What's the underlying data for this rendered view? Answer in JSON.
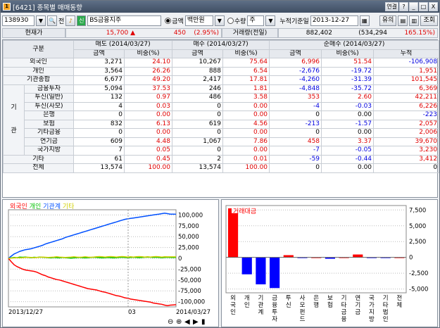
{
  "window": {
    "number": "1",
    "title": "[6421] 종목별 매매동향",
    "buttons": [
      "연결",
      "?",
      "_",
      "□",
      "X"
    ]
  },
  "toolbar": {
    "code": "138930",
    "jeon": "전",
    "sin": "신",
    "stock_name": "BS금융지주",
    "radio_amount": "금액",
    "unit": "백만원",
    "radio_qty": "수량",
    "period": "주",
    "ref_date_label": "누적기준일",
    "ref_date": "2013-12-27",
    "btn_yuui": "유의",
    "btn_query": "조회"
  },
  "quote": {
    "price_label": "현재가",
    "price": "15,700",
    "change_arrow": "▲",
    "change": "450",
    "change_pct": "(2.95%)",
    "volume_label": "거래량(전일)",
    "volume": "882,402",
    "prev_volume": "(534,294",
    "volume_pct": "165.15%)"
  },
  "table": {
    "header_group": [
      "구분",
      "매도 (2014/03/27)",
      "매수 (2014/03/27)",
      "순매수 (2014/03/27)"
    ],
    "header_sub": [
      "금액",
      "비중(%)",
      "금액",
      "비중(%)",
      "금액",
      "비중(%)",
      "누적"
    ],
    "gi_label": "기",
    "gwan_label": "관",
    "rows": [
      {
        "label": "외국인",
        "indent": false,
        "cells": [
          "3,271",
          "24.10",
          "10,267",
          "75.64",
          "6,996",
          "51.54",
          "-106,908"
        ],
        "cls": [
          "",
          "red",
          "",
          "red",
          "red",
          "red",
          "blue"
        ]
      },
      {
        "label": "개인",
        "indent": false,
        "cells": [
          "3,564",
          "26.26",
          "888",
          "6.54",
          "-2,676",
          "-19.72",
          "1,951"
        ],
        "cls": [
          "",
          "red",
          "",
          "red",
          "blue",
          "blue",
          "red"
        ]
      },
      {
        "label": "기관종합",
        "indent": false,
        "cells": [
          "6,677",
          "49.20",
          "2,417",
          "17.81",
          "-4,260",
          "-31.39",
          "101,545"
        ],
        "cls": [
          "",
          "red",
          "",
          "red",
          "blue",
          "blue",
          "red"
        ]
      },
      {
        "label": "금융투자",
        "indent": true,
        "cells": [
          "5,094",
          "37.53",
          "246",
          "1.81",
          "-4,848",
          "-35.72",
          "6,369"
        ],
        "cls": [
          "",
          "red",
          "",
          "red",
          "blue",
          "blue",
          "red"
        ]
      },
      {
        "label": "투신(일반)",
        "indent": true,
        "cells": [
          "132",
          "0.97",
          "486",
          "3.58",
          "353",
          "2.60",
          "42,211"
        ],
        "cls": [
          "",
          "red",
          "",
          "red",
          "red",
          "red",
          "red"
        ]
      },
      {
        "label": "투신(사모)",
        "indent": true,
        "cells": [
          "4",
          "0.03",
          "0",
          "0.00",
          "-4",
          "-0.03",
          "6,226"
        ],
        "cls": [
          "",
          "red",
          "",
          "red",
          "blue",
          "blue",
          "red"
        ]
      },
      {
        "label": "은행",
        "indent": true,
        "cells": [
          "0",
          "0.00",
          "0",
          "0.00",
          "0",
          "0.00",
          "-223"
        ],
        "cls": [
          "",
          "red",
          "",
          "red",
          "",
          "",
          "blue"
        ]
      },
      {
        "label": "보험",
        "indent": true,
        "cells": [
          "832",
          "6.13",
          "619",
          "4.56",
          "-213",
          "-1.57",
          "2,057"
        ],
        "cls": [
          "",
          "red",
          "",
          "red",
          "blue",
          "blue",
          "red"
        ]
      },
      {
        "label": "기타금융",
        "indent": true,
        "cells": [
          "0",
          "0.00",
          "0",
          "0.00",
          "0",
          "0.00",
          "2,006"
        ],
        "cls": [
          "",
          "red",
          "",
          "red",
          "",
          "",
          "red"
        ]
      },
      {
        "label": "연기금",
        "indent": true,
        "cells": [
          "609",
          "4.48",
          "1,067",
          "7.86",
          "458",
          "3.37",
          "39,670"
        ],
        "cls": [
          "",
          "red",
          "",
          "red",
          "red",
          "red",
          "red"
        ]
      },
      {
        "label": "국가지방",
        "indent": true,
        "cells": [
          "7",
          "0.05",
          "0",
          "0.00",
          "-7",
          "-0.05",
          "3,230"
        ],
        "cls": [
          "",
          "red",
          "",
          "red",
          "blue",
          "blue",
          "red"
        ]
      },
      {
        "label": "기타",
        "indent": false,
        "cells": [
          "61",
          "0.45",
          "2",
          "0.01",
          "-59",
          "-0.44",
          "3,412"
        ],
        "cls": [
          "",
          "red",
          "",
          "red",
          "blue",
          "blue",
          "red"
        ]
      },
      {
        "label": "전체",
        "indent": false,
        "cells": [
          "13,574",
          "100.00",
          "13,574",
          "100.00",
          "0",
          "0.00",
          "0"
        ],
        "cls": [
          "",
          "red",
          "",
          "red",
          "",
          "",
          ""
        ]
      }
    ]
  },
  "chart_data": [
    {
      "type": "line",
      "legend": [
        "외국인",
        "개인",
        "기관계",
        "기타"
      ],
      "colors": [
        "#ff0000",
        "#00c000",
        "#0050ff",
        "#d0d000"
      ],
      "yticks": [
        100000,
        75000,
        50000,
        25000,
        0,
        -25000,
        -50000,
        -75000,
        -100000
      ],
      "ytick_labels": [
        "100,000",
        "75,000",
        "50,000",
        "25,000",
        "0",
        "-25,000",
        "-50,000",
        "-75,000",
        "-100,000"
      ],
      "ylim": [
        -112000,
        112000
      ],
      "xlabels": [
        "2013/12/27",
        "03",
        "2014/03/27"
      ],
      "n_points": 60,
      "series": [
        {
          "name": "외국인",
          "values": [
            0,
            -8000,
            -15000,
            -19000,
            -22000,
            -25000,
            -27000,
            -28000,
            -29000,
            -30000,
            -32000,
            -35000,
            -38000,
            -40000,
            -43000,
            -45000,
            -47000,
            -49000,
            -50000,
            -52000,
            -54000,
            -56000,
            -58000,
            -60000,
            -62000,
            -64000,
            -66000,
            -68000,
            -70000,
            -71000,
            -72000,
            -73000,
            -75000,
            -77000,
            -78000,
            -80000,
            -82000,
            -84000,
            -86000,
            -87000,
            -89000,
            -91000,
            -92000,
            -94000,
            -95000,
            -96000,
            -97000,
            -98000,
            -99000,
            -100000,
            -101000,
            -103000,
            -104000,
            -105000,
            -106000,
            -108000,
            -109000,
            -108000,
            -107500,
            -106908
          ]
        },
        {
          "name": "개인",
          "values": [
            0,
            1000,
            2000,
            1500,
            3000,
            2500,
            3000,
            2000,
            1500,
            2500,
            2000,
            3000,
            2500,
            2000,
            1500,
            1000,
            2000,
            1500,
            1000,
            2000,
            1500,
            1000,
            500,
            1000,
            1500,
            2000,
            1500,
            1000,
            1500,
            2000,
            2500,
            2000,
            1500,
            1000,
            1500,
            2000,
            1500,
            1000,
            1500,
            2000,
            2500,
            2000,
            1500,
            2000,
            2500,
            2000,
            1500,
            2000,
            2500,
            3000,
            2500,
            2000,
            2500,
            2000,
            1500,
            2000,
            2500,
            2000,
            1800,
            1951
          ]
        },
        {
          "name": "기관계",
          "values": [
            0,
            5000,
            10000,
            13000,
            16000,
            18000,
            20000,
            21000,
            22000,
            24000,
            26000,
            28000,
            30000,
            33000,
            35000,
            37000,
            39000,
            41000,
            43000,
            45000,
            48000,
            50000,
            52000,
            54000,
            56000,
            58000,
            60000,
            62000,
            64000,
            66000,
            68000,
            70000,
            72000,
            74000,
            76000,
            78000,
            80000,
            82000,
            84000,
            86000,
            88000,
            90000,
            91000,
            92000,
            93000,
            94000,
            95000,
            96000,
            97000,
            98000,
            99000,
            100000,
            101000,
            102000,
            103000,
            104000,
            103000,
            102000,
            101800,
            101545
          ]
        },
        {
          "name": "기타",
          "values": [
            0,
            500,
            1000,
            1500,
            1000,
            1500,
            2000,
            2500,
            2000,
            1500,
            2000,
            2500,
            3000,
            2500,
            2000,
            2500,
            3000,
            3500,
            3000,
            2500,
            2000,
            2500,
            3000,
            3500,
            3000,
            2500,
            3000,
            3500,
            3000,
            2500,
            3000,
            3500,
            4000,
            3500,
            3000,
            3500,
            4000,
            3500,
            3000,
            3500,
            4000,
            3500,
            3000,
            3500,
            3000,
            3500,
            4000,
            3500,
            3000,
            3500,
            3000,
            3500,
            4000,
            3500,
            3000,
            3500,
            3400,
            3450,
            3420,
            3412
          ]
        }
      ]
    },
    {
      "type": "bar",
      "legend": [
        "거래대금"
      ],
      "categories": [
        "외국인",
        "개인",
        "기관계",
        "금융투자",
        "투신",
        "사모펀드",
        "은행",
        "보험",
        "기타금융",
        "연기금",
        "국가지방",
        "기타법인",
        "전체"
      ],
      "values": [
        6996,
        -2676,
        -4260,
        -4848,
        353,
        -4,
        0,
        -213,
        0,
        458,
        -7,
        -59,
        0
      ],
      "yticks": [
        7500,
        5000,
        2500,
        0,
        -2500,
        -5000
      ],
      "ytick_labels": [
        "7,500",
        "5,000",
        "2,500",
        "0",
        "-2,500",
        "-5,000"
      ],
      "ylim": [
        -5600,
        8200
      ],
      "positive_color": "#ff0000",
      "negative_color": "#0000ff"
    }
  ]
}
